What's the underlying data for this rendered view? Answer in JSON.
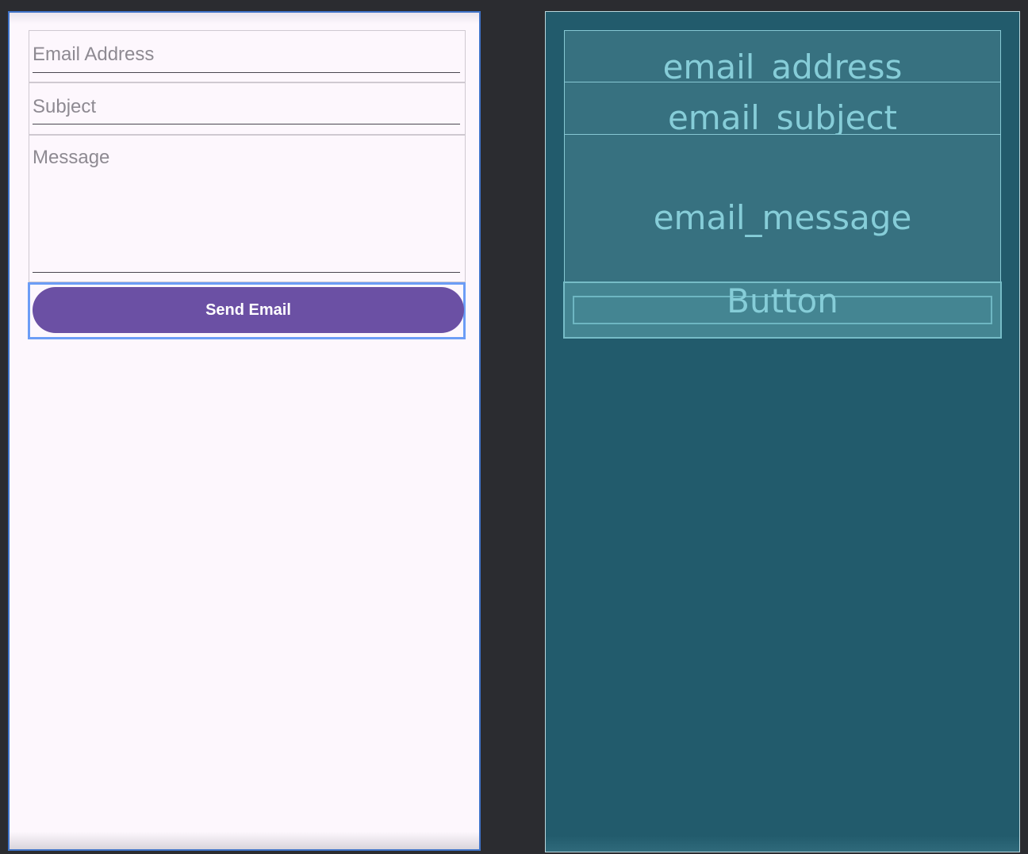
{
  "form": {
    "email_placeholder": "Email Address",
    "subject_placeholder": "Subject",
    "message_placeholder": "Message",
    "send_label": "Send Email"
  },
  "blueprint": {
    "email_id": "email_address",
    "subject_id": "email_subject",
    "message_id": "email_message",
    "button_id": "Button"
  },
  "colors": {
    "button_bg": "#6b50a4",
    "blueprint_bg": "#225b6c",
    "selection": "#6c9df6"
  }
}
